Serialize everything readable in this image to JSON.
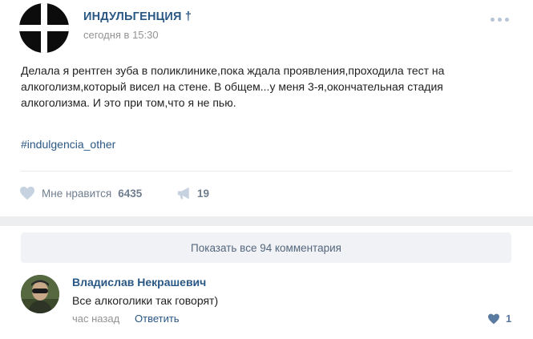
{
  "post": {
    "group_name": "ИНДУЛЬГЕНЦИЯ †",
    "time": "сегодня в 15:30",
    "text_lines": [
      "Делала я рентген зуба в поликлинике,пока ждала проявления,проходила тест на",
      "алкоголизм,который висел на стене. В общем...у меня 3-я,окончательная стадия",
      "алкоголизма. И это при том,что я не пью."
    ],
    "hashtag": "#indulgencia_other",
    "like_label": "Мне нравится",
    "like_count": "6435",
    "share_count": "19",
    "more_icon": "more-dots-icon"
  },
  "comments": {
    "show_all_label": "Показать все 94 комментария",
    "items": [
      {
        "author": "Владислав Некрашевич",
        "text": "Все алкоголики так говорят)",
        "time": "час назад",
        "reply_label": "Ответить",
        "like_count": "1"
      }
    ]
  },
  "colors": {
    "link": "#2a5885",
    "muted": "#939393",
    "icon": "#b7c5d6",
    "background_band": "#edeef0"
  }
}
